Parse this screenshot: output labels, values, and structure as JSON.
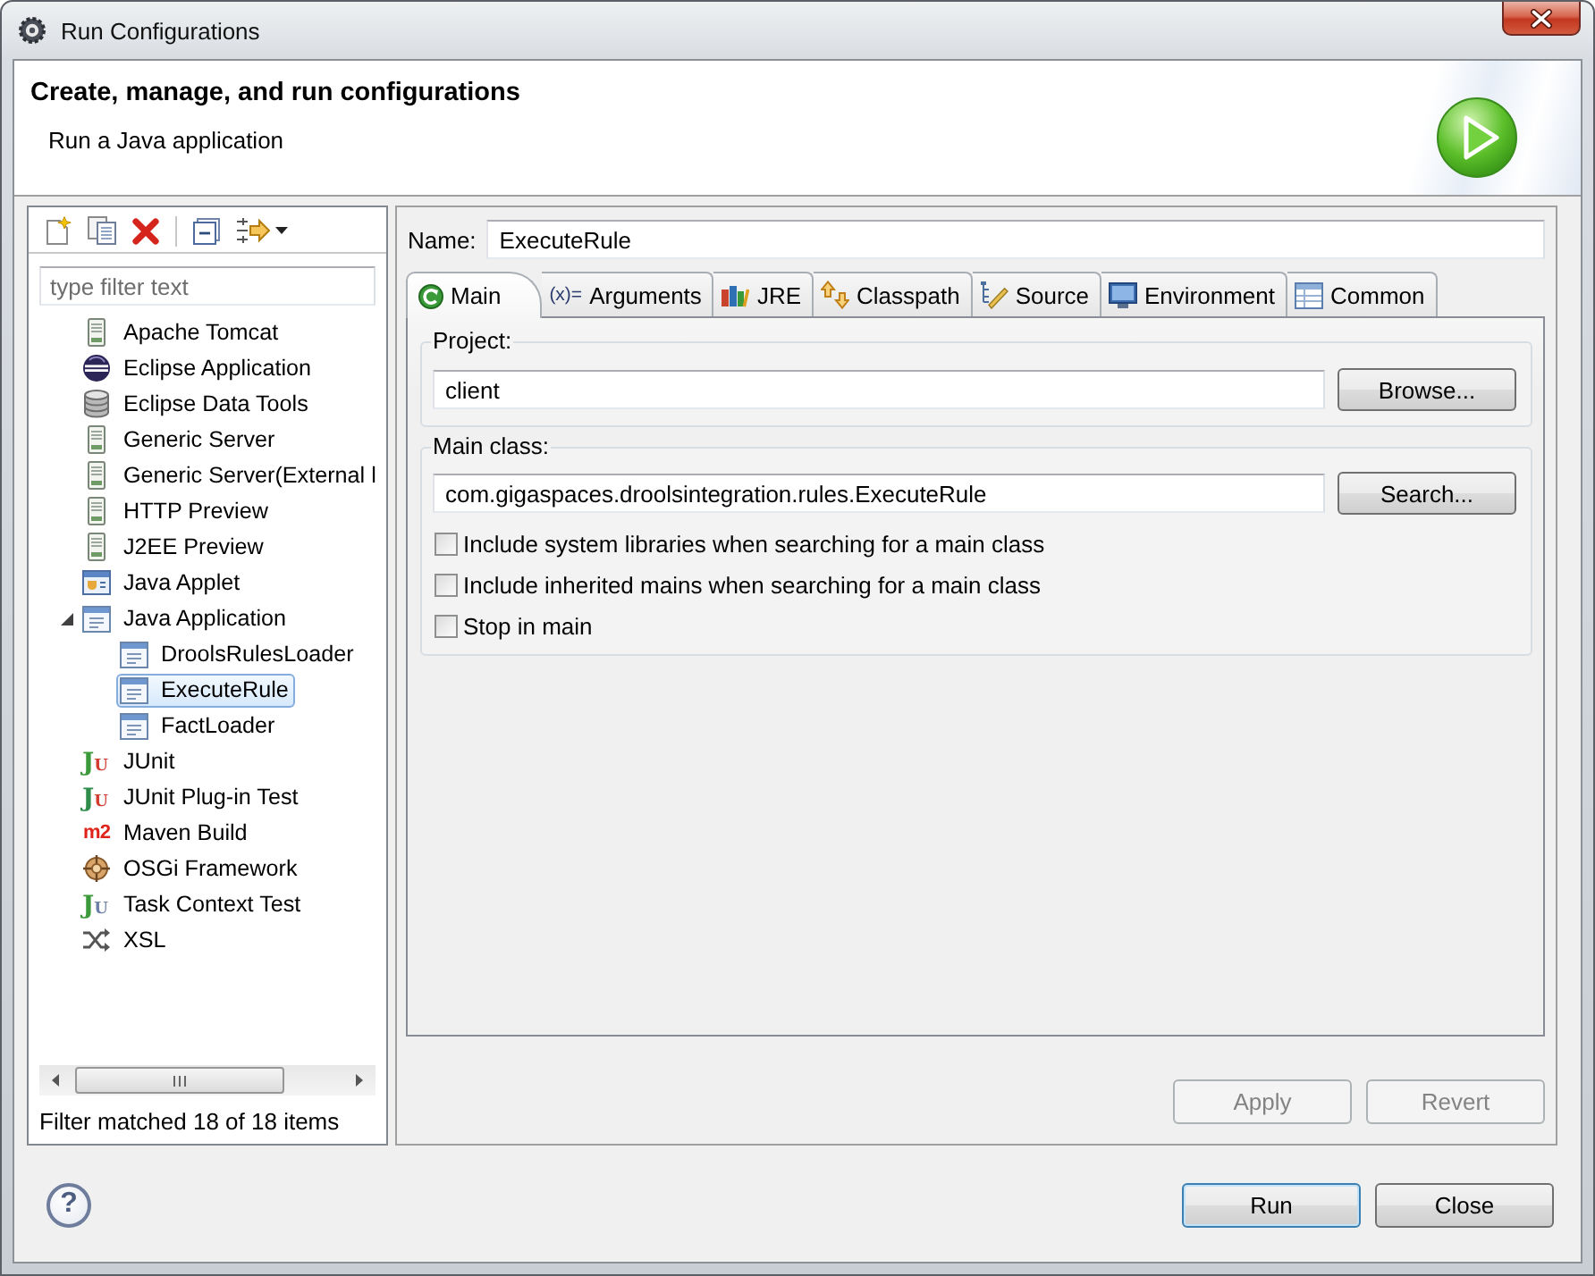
{
  "window": {
    "title": "Run Configurations"
  },
  "header": {
    "title": "Create, manage, and run configurations",
    "subtitle": "Run a Java application"
  },
  "filter": {
    "placeholder": "type filter text"
  },
  "tree": [
    {
      "label": "Apache Tomcat",
      "kind": "server",
      "selected": false
    },
    {
      "label": "Eclipse Application",
      "kind": "eclipse",
      "selected": false
    },
    {
      "label": "Eclipse Data Tools",
      "kind": "database",
      "selected": false
    },
    {
      "label": "Generic Server",
      "kind": "server",
      "selected": false
    },
    {
      "label": "Generic Server(External l",
      "kind": "server",
      "selected": false
    },
    {
      "label": "HTTP Preview",
      "kind": "server",
      "selected": false
    },
    {
      "label": "J2EE Preview",
      "kind": "server",
      "selected": false
    },
    {
      "label": "Java Applet",
      "kind": "applet",
      "selected": false
    },
    {
      "label": "Java Application",
      "kind": "java",
      "selected": false,
      "expanded": true,
      "children": [
        {
          "label": "DroolsRulesLoader",
          "kind": "java",
          "selected": false
        },
        {
          "label": "ExecuteRule",
          "kind": "java",
          "selected": true
        },
        {
          "label": "FactLoader",
          "kind": "java",
          "selected": false
        }
      ]
    },
    {
      "label": "JUnit",
      "kind": "junit",
      "icon_text": "JU",
      "selected": false
    },
    {
      "label": "JUnit Plug-in Test",
      "kind": "junit-plugin",
      "icon_text": "JU",
      "selected": false
    },
    {
      "label": "Maven Build",
      "kind": "maven",
      "icon_text": "m2",
      "selected": false
    },
    {
      "label": "OSGi Framework",
      "kind": "osgi",
      "selected": false
    },
    {
      "label": "Task Context Test",
      "kind": "task-test",
      "icon_text": "JU",
      "selected": false
    },
    {
      "label": "XSL",
      "kind": "xsl",
      "selected": false
    }
  ],
  "status": "Filter matched 18 of 18 items",
  "name": {
    "label": "Name:",
    "value": "ExecuteRule"
  },
  "tabs": [
    {
      "label": "Main",
      "kind": "main",
      "selected": true
    },
    {
      "label": "Arguments",
      "kind": "arguments",
      "icon_text": "(x)=",
      "selected": false
    },
    {
      "label": "JRE",
      "kind": "jre",
      "selected": false
    },
    {
      "label": "Classpath",
      "kind": "classpath",
      "selected": false
    },
    {
      "label": "Source",
      "kind": "source",
      "selected": false
    },
    {
      "label": "Environment",
      "kind": "environment",
      "selected": false
    },
    {
      "label": "Common",
      "kind": "common",
      "selected": false
    }
  ],
  "project": {
    "label": "Project:",
    "value": "client",
    "button": "Browse..."
  },
  "main_class": {
    "label": "Main class:",
    "value": "com.gigaspaces.droolsintegration.rules.ExecuteRule",
    "button": "Search..."
  },
  "options": [
    {
      "label": "Include system libraries when searching for a main class",
      "checked": false
    },
    {
      "label": "Include inherited mains when searching for a main class",
      "checked": false
    },
    {
      "label": "Stop in main",
      "checked": false
    }
  ],
  "apply": {
    "label": "Apply",
    "disabled": true
  },
  "revert": {
    "label": "Revert",
    "disabled": true
  },
  "help": {
    "label": "?"
  },
  "run": {
    "label": "Run",
    "focused": true
  },
  "close": {
    "label": "Close",
    "focused": false
  }
}
